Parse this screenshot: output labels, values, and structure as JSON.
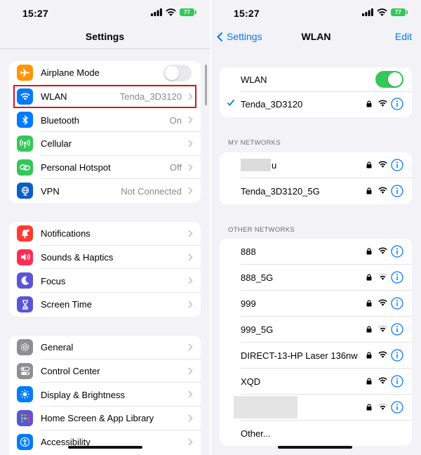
{
  "status": {
    "time": "15:27",
    "battery": "77"
  },
  "settings": {
    "title": "Settings",
    "groups": [
      {
        "items": [
          {
            "label": "Airplane Mode",
            "value": "",
            "icon": "airplane-icon",
            "color": "#ff9500",
            "control": "toggle-off"
          },
          {
            "label": "WLAN",
            "value": "Tenda_3D3120",
            "icon": "wifi-icon",
            "color": "#007aff",
            "control": "chevron",
            "highlighted": true
          },
          {
            "label": "Bluetooth",
            "value": "On",
            "icon": "bluetooth-icon",
            "color": "#007aff",
            "control": "chevron"
          },
          {
            "label": "Cellular",
            "value": "",
            "icon": "cellular-icon",
            "color": "#34c759",
            "control": "chevron"
          },
          {
            "label": "Personal Hotspot",
            "value": "Off",
            "icon": "hotspot-icon",
            "color": "#34c759",
            "control": "chevron"
          },
          {
            "label": "VPN",
            "value": "Not Connected",
            "icon": "globe-icon",
            "color": "#0a5ec7",
            "control": "chevron"
          }
        ]
      },
      {
        "items": [
          {
            "label": "Notifications",
            "icon": "bell-icon",
            "color": "#ff3b30"
          },
          {
            "label": "Sounds & Haptics",
            "icon": "speaker-icon",
            "color": "#ff2d55"
          },
          {
            "label": "Focus",
            "icon": "moon-icon",
            "color": "#5856d6"
          },
          {
            "label": "Screen Time",
            "icon": "hourglass-icon",
            "color": "#5856d6"
          }
        ]
      },
      {
        "items": [
          {
            "label": "General",
            "icon": "gear-icon",
            "color": "#8e8e93"
          },
          {
            "label": "Control Center",
            "icon": "toggles-icon",
            "color": "#8e8e93"
          },
          {
            "label": "Display & Brightness",
            "icon": "sun-icon",
            "color": "#007aff"
          },
          {
            "label": "Home Screen & App Library",
            "icon": "grid-icon",
            "color": "#5856d6"
          },
          {
            "label": "Accessibility",
            "icon": "accessibility-icon",
            "color": "#007aff"
          }
        ]
      }
    ]
  },
  "wlan": {
    "back_label": "Settings",
    "title": "WLAN",
    "edit_label": "Edit",
    "toggle_label": "WLAN",
    "wlan_on": true,
    "connected": "Tenda_3D3120",
    "my_networks_header": "MY NETWORKS",
    "my_networks": [
      {
        "name": "u",
        "obscured": true
      },
      {
        "name": "Tenda_3D3120_5G"
      }
    ],
    "other_networks_header": "OTHER NETWORKS",
    "other_networks": [
      {
        "name": "888"
      },
      {
        "name": "888_5G"
      },
      {
        "name": "999"
      },
      {
        "name": "999_5G"
      },
      {
        "name": "DIRECT-13-HP Laser 136nw"
      },
      {
        "name": "XQD"
      },
      {
        "name": "",
        "obscured": true
      }
    ],
    "other_label": "Other..."
  },
  "colors": {
    "accent": "#007aff",
    "toggle_on": "#34c759",
    "highlight": "#d1181f"
  }
}
